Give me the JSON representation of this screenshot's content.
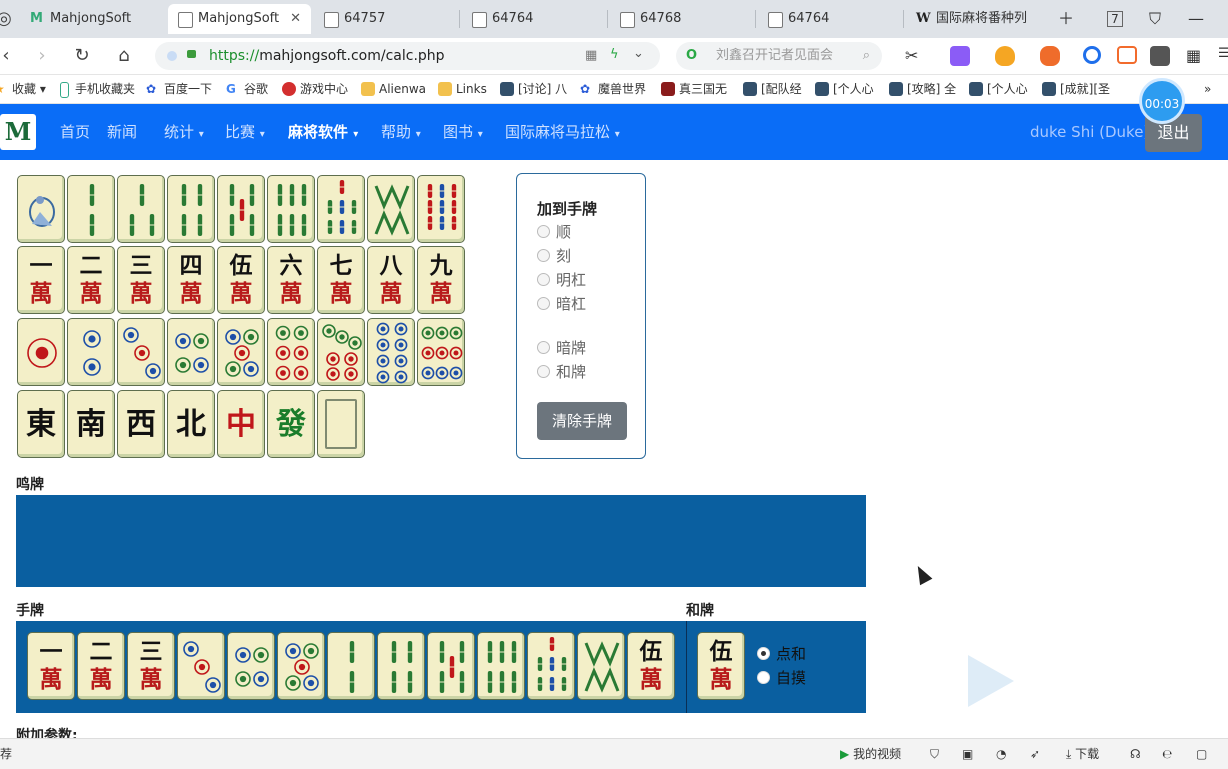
{
  "browser": {
    "tabs": [
      {
        "label": "MahjongSoft",
        "active": false
      },
      {
        "label": "MahjongSoft",
        "active": true
      },
      {
        "label": "64757",
        "active": false
      },
      {
        "label": "64764",
        "active": false
      },
      {
        "label": "64768",
        "active": false
      },
      {
        "label": "64764",
        "active": false
      },
      {
        "label": "国际麻将番种列",
        "active": false
      }
    ],
    "tab_count": "7",
    "url_protocol": "https://",
    "url_rest": "mahjongsoft.com/calc.php",
    "search_placeholder": "刘鑫召开记者见面会",
    "bookmarks": [
      "收藏",
      "手机收藏夹",
      "百度一下",
      "谷歌",
      "游戏中心",
      "Alienwa",
      "Links",
      "[讨论] 八",
      "魔兽世界",
      "真三国无",
      "[配队经",
      "[个人心",
      "[攻略] 全",
      "[个人心",
      "[成就][圣"
    ],
    "timer": "00:03"
  },
  "site_nav": {
    "items": [
      {
        "label": "首页",
        "dropdown": false,
        "active": false
      },
      {
        "label": "新闻",
        "dropdown": false,
        "active": false
      },
      {
        "label": "统计",
        "dropdown": true,
        "active": false
      },
      {
        "label": "比赛",
        "dropdown": true,
        "active": false
      },
      {
        "label": "麻将软件",
        "dropdown": true,
        "active": true
      },
      {
        "label": "帮助",
        "dropdown": true,
        "active": false
      },
      {
        "label": "图书",
        "dropdown": true,
        "active": false
      },
      {
        "label": "国际麻将马拉松",
        "dropdown": true,
        "active": false
      }
    ],
    "user": "duke Shi (Duke)",
    "logout": "退出"
  },
  "palette": {
    "bamboo": [
      1,
      2,
      3,
      4,
      5,
      6,
      7,
      8,
      9
    ],
    "characters": [
      "一",
      "二",
      "三",
      "四",
      "伍",
      "六",
      "七",
      "八",
      "九"
    ],
    "wan": "萬",
    "dots": [
      1,
      2,
      3,
      4,
      5,
      6,
      7,
      8,
      9
    ],
    "honors": [
      {
        "char": "東",
        "color": "#111111"
      },
      {
        "char": "南",
        "color": "#111111"
      },
      {
        "char": "西",
        "color": "#111111"
      },
      {
        "char": "北",
        "color": "#111111"
      },
      {
        "char": "中",
        "color": "#c0171a"
      },
      {
        "char": "發",
        "color": "#1a7d2a"
      },
      {
        "char": "",
        "color": "#111111"
      }
    ]
  },
  "add_panel": {
    "title": "加到手牌",
    "options": [
      "顺",
      "刻",
      "明杠",
      "暗杠"
    ],
    "options2": [
      "暗牌",
      "和牌"
    ],
    "clear_button": "清除手牌"
  },
  "labels": {
    "melds": "鸣牌",
    "hand": "手牌",
    "winning": "和牌",
    "extra": "附加参数:"
  },
  "hand": [
    {
      "suit": "char",
      "rank": 1
    },
    {
      "suit": "char",
      "rank": 2
    },
    {
      "suit": "char",
      "rank": 3
    },
    {
      "suit": "dot",
      "rank": 3
    },
    {
      "suit": "dot",
      "rank": 4
    },
    {
      "suit": "dot",
      "rank": 5
    },
    {
      "suit": "bam",
      "rank": 2
    },
    {
      "suit": "bam",
      "rank": 4
    },
    {
      "suit": "bam",
      "rank": 5
    },
    {
      "suit": "bam",
      "rank": 6
    },
    {
      "suit": "bam",
      "rank": 7
    },
    {
      "suit": "bam",
      "rank": 8
    },
    {
      "suit": "char",
      "rank": 5
    }
  ],
  "winning_tile": {
    "suit": "char",
    "rank": 5
  },
  "win_type": {
    "options": [
      "点和",
      "自摸"
    ],
    "selected": "点和"
  },
  "statusbar": {
    "left": "荐",
    "video": "我的视频",
    "download": "下载"
  }
}
